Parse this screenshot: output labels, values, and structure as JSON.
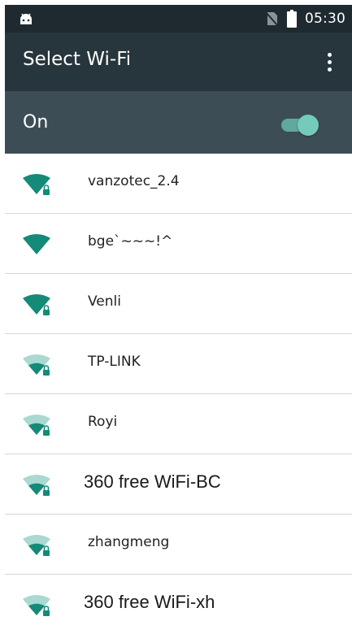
{
  "status_bar": {
    "time": "05:30",
    "left_icon": "android-icon",
    "icons": [
      "no-sim-icon",
      "battery-icon"
    ]
  },
  "toolbar": {
    "title": "Select Wi-Fi",
    "menu_icon": "overflow-menu-icon"
  },
  "wifi_switch": {
    "label": "On",
    "state": "on",
    "accent": "#74cbbb"
  },
  "networks": [
    {
      "name": "vanzotec_2.4",
      "signal": "full",
      "secured": true
    },
    {
      "name": "bge`~~~!^",
      "signal": "full",
      "secured": false
    },
    {
      "name": "Venli",
      "signal": "full",
      "secured": true
    },
    {
      "name": "TP-LINK",
      "signal": "medium",
      "secured": true
    },
    {
      "name": "Royi",
      "signal": "medium",
      "secured": true
    },
    {
      "name": "360 free WiFi-BC",
      "signal": "medium",
      "secured": true
    },
    {
      "name": "zhangmeng",
      "signal": "medium",
      "secured": true
    },
    {
      "name": "360 free WiFi-xh",
      "signal": "medium",
      "secured": true
    }
  ],
  "colors": {
    "status_bar": "#1f2a30",
    "toolbar": "#27353c",
    "switch_bar": "#3c4d55",
    "wifi_icon": "#148a78",
    "wifi_icon_faint": "#a9d9d0"
  }
}
